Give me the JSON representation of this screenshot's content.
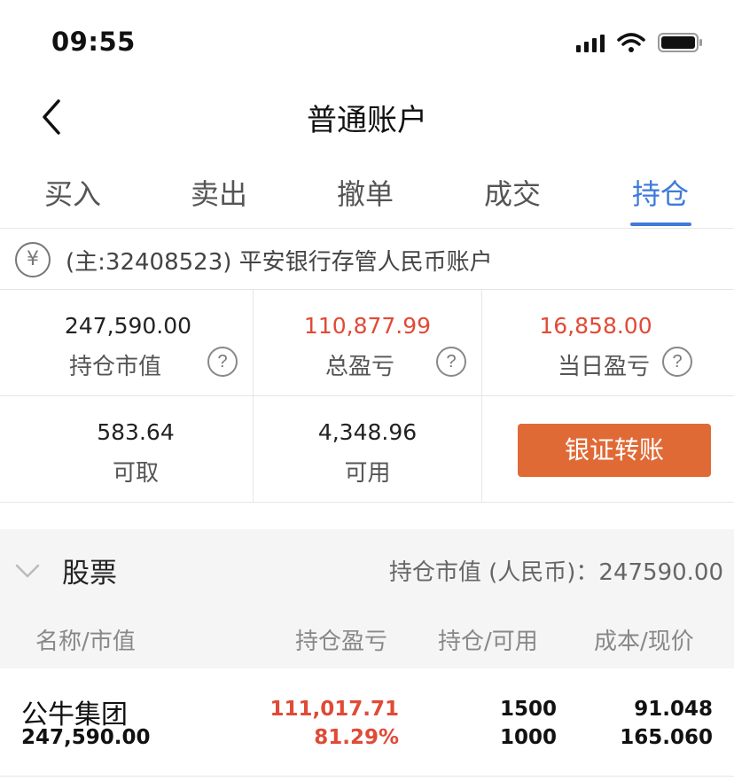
{
  "status_bar": {
    "time": "09:55",
    "icons": [
      "signal-icon",
      "wifi-icon",
      "battery-icon"
    ]
  },
  "nav": {
    "back_icon": "chevron-left-icon",
    "title": "普通账户"
  },
  "tabs": [
    {
      "label": "买入"
    },
    {
      "label": "卖出"
    },
    {
      "label": "撤单"
    },
    {
      "label": "成交"
    },
    {
      "label": "持仓"
    }
  ],
  "active_tab": "持仓",
  "account": {
    "icon": "yen-icon",
    "symbol": "¥",
    "text": "(主:32408523) 平安银行存管人民币账户"
  },
  "stats": {
    "market_value": {
      "value": "247,590.00",
      "label": "持仓市值"
    },
    "total_pnl": {
      "value": "110,877.99",
      "label": "总盈亏"
    },
    "daily_pnl": {
      "value": "16,858.00",
      "label": "当日盈亏"
    },
    "withdrawable": {
      "value": "583.64",
      "label": "可取"
    },
    "available": {
      "value": "4,348.96",
      "label": "可用"
    },
    "help_symbol": "?",
    "transfer_label": "银证转账"
  },
  "stock_section": {
    "title": "股票",
    "summary": "持仓市值 (人民币)：247590.00",
    "columns": [
      "名称/市值",
      "持仓盈亏",
      "持仓/可用",
      "成本/现价"
    ],
    "rows": [
      {
        "name": "公牛集团",
        "market_value": "247,590.00",
        "pnl": "111,017.71",
        "pnl_pct": "81.29%",
        "holding": "1500",
        "available": "1000",
        "cost": "91.048",
        "price": "165.060"
      }
    ]
  },
  "colors": {
    "accent": "#3f7ad9",
    "profit": "#e04a36",
    "button": "#e06a36"
  }
}
